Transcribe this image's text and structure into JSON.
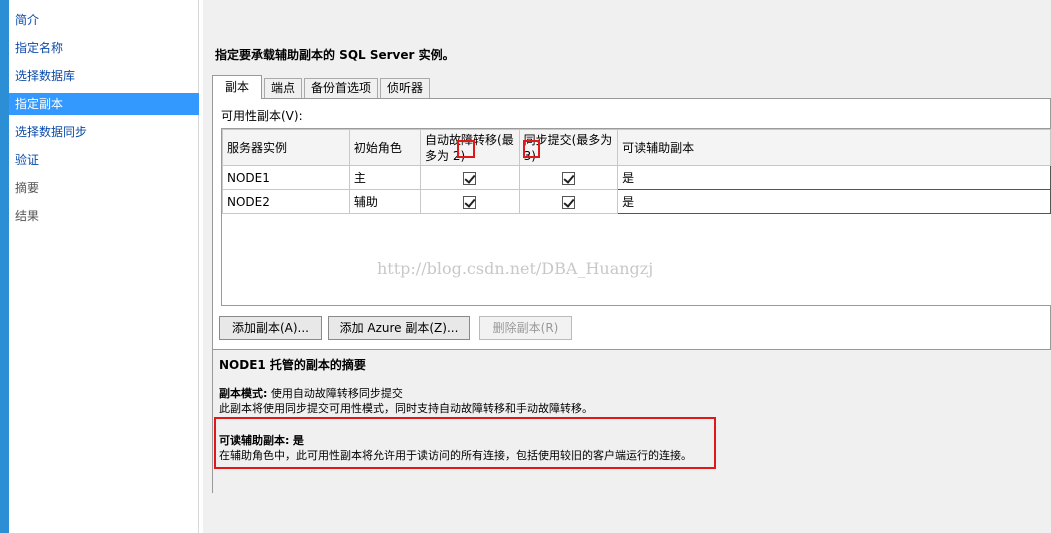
{
  "sidebar": {
    "items": [
      {
        "label": "简介",
        "state": "link"
      },
      {
        "label": "指定名称",
        "state": "link"
      },
      {
        "label": "选择数据库",
        "state": "link"
      },
      {
        "label": "指定副本",
        "state": "selected"
      },
      {
        "label": "选择数据同步",
        "state": "link"
      },
      {
        "label": "验证",
        "state": "link"
      },
      {
        "label": "摘要",
        "state": "disabled"
      },
      {
        "label": "结果",
        "state": "disabled"
      }
    ]
  },
  "main": {
    "instruction": "指定要承载辅助副本的 SQL Server 实例。",
    "tabs": [
      {
        "label": "副本",
        "active": true
      },
      {
        "label": "端点",
        "active": false
      },
      {
        "label": "备份首选项",
        "active": false
      },
      {
        "label": "侦听器",
        "active": false
      }
    ],
    "availability_label": "可用性副本(V):",
    "grid": {
      "columns": [
        "服务器实例",
        "初始角色",
        "自动故障转移(最多为 2)",
        "同步提交(最多为 3)",
        "可读辅助副本"
      ],
      "rows": [
        {
          "server": "NODE1",
          "role": "主",
          "auto_failover": true,
          "sync_commit": true,
          "readable": "是"
        },
        {
          "server": "NODE2",
          "role": "辅助",
          "auto_failover": true,
          "sync_commit": true,
          "readable": "是"
        }
      ]
    },
    "watermark": "http://blog.csdn.net/DBA_Huangzj",
    "buttons": {
      "add_replica": "添加副本(A)...",
      "add_azure": "添加 Azure 副本(Z)...",
      "remove_replica": "删除副本(R)"
    },
    "summary": {
      "title": "NODE1 托管的副本的摘要",
      "mode_label": "副本模式:",
      "mode_value": "使用自动故障转移同步提交",
      "mode_desc": "此副本将使用同步提交可用性模式，同时支持自动故障转移和手动故障转移。",
      "readable_label": "可读辅助副本:",
      "readable_value": "是",
      "readable_desc": "在辅助角色中，此可用性副本将允许用于读访问的所有连接，包括使用较旧的客户端运行的连接。"
    }
  },
  "colors": {
    "selected_nav": "#3399ff",
    "link": "#0b4aa8",
    "annotation_red": "#e01818",
    "left_edge": "#2c8fd6"
  }
}
